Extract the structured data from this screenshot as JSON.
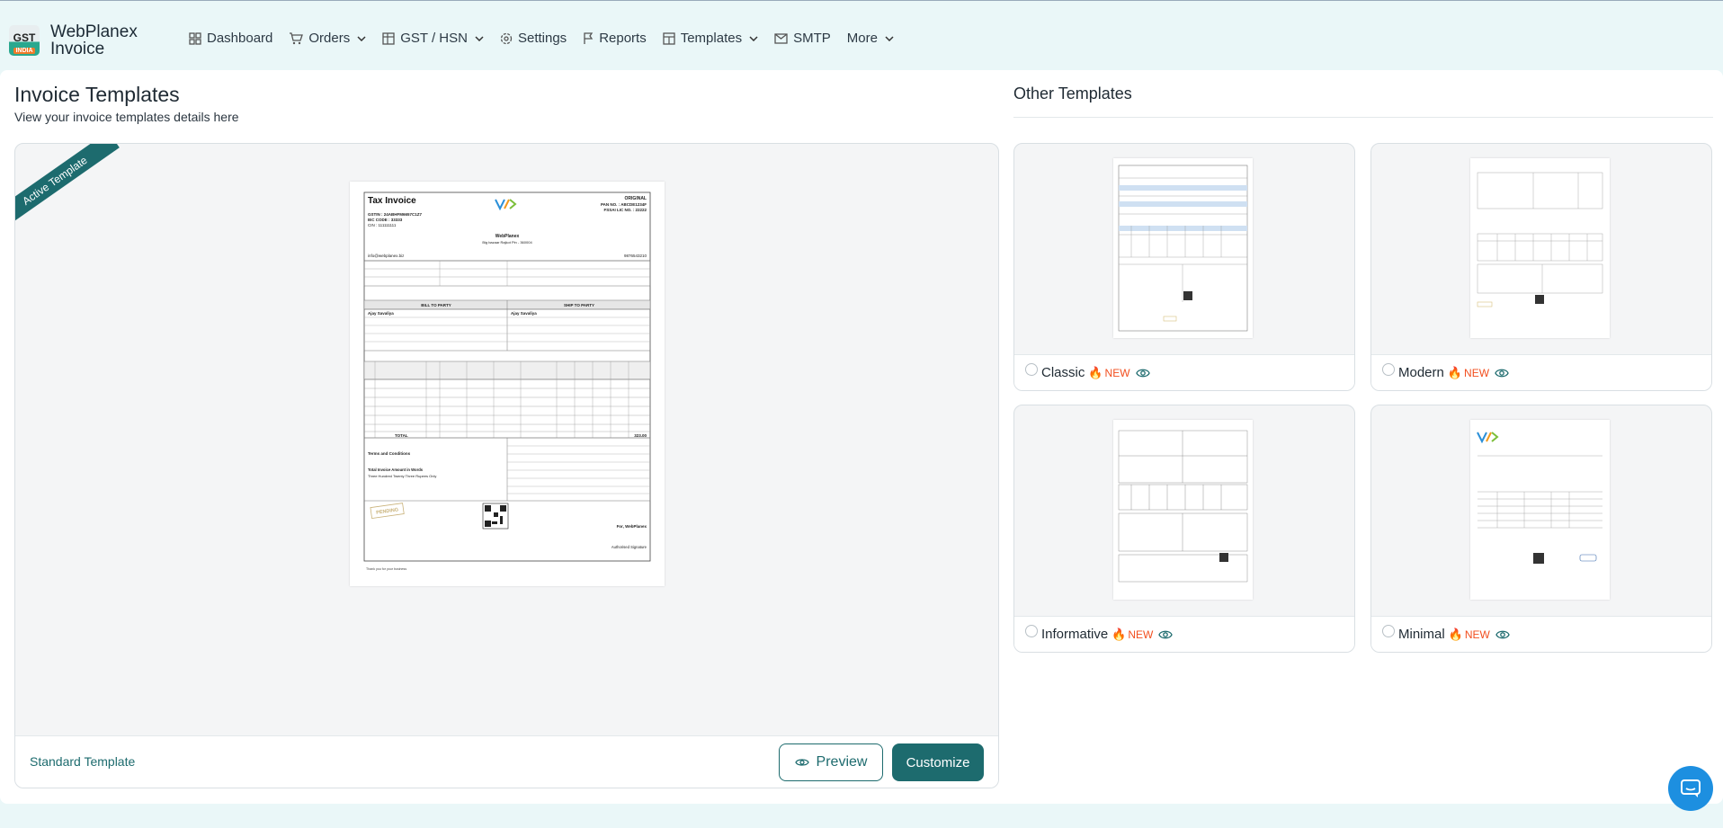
{
  "app": {
    "logo_top": "GST",
    "logo_bottom": "INDIA",
    "name_line1": "WebPlanex",
    "name_line2": "Invoice"
  },
  "nav": {
    "dashboard": "Dashboard",
    "orders": "Orders",
    "gst_hsn": "GST / HSN",
    "settings": "Settings",
    "reports": "Reports",
    "templates": "Templates",
    "smtp": "SMTP",
    "more": "More"
  },
  "page": {
    "title": "Invoice Templates",
    "subtitle": "View your invoice templates details here",
    "other_title": "Other Templates"
  },
  "active_template": {
    "ribbon": "Active Template",
    "name": "Standard Template",
    "preview_label": "Preview",
    "customize_label": "Customize"
  },
  "invoice": {
    "heading": "Tax Invoice",
    "original": "ORIGINAL",
    "pan": "PAN NO. : ABCDE1234F",
    "fssai": "FSSAI LIC NO. : 22222",
    "gstin": "GSTIN : 24ABHFM6657C1Z7",
    "iec": "IEC CODE : 33333",
    "cin": "CIN : 111111111",
    "company": "WebPlanex",
    "address": "Big bazaar Rajkot Pin - 360004",
    "email": "info@webplanex.biz",
    "phone": "9876543210",
    "bill_to": "BILL TO PARTY",
    "ship_to": "SHIP TO PARTY",
    "party": "Ajay Savaliya",
    "total_label": "TOTAL",
    "total_value": "323.00",
    "pending": "PENDING",
    "terms": "Terms and Conditions",
    "words_label": "Total Invoice Amount in Words",
    "words": "Three Hundred Twenty Three Rupees Only",
    "for": "For, WebPlanex",
    "sign": "Authorised Signature",
    "thanks": "Thank you for your business"
  },
  "templates": [
    {
      "name": "Classic",
      "badge": "NEW"
    },
    {
      "name": "Modern",
      "badge": "NEW"
    },
    {
      "name": "Informative",
      "badge": "NEW"
    },
    {
      "name": "Minimal",
      "badge": "NEW"
    }
  ]
}
